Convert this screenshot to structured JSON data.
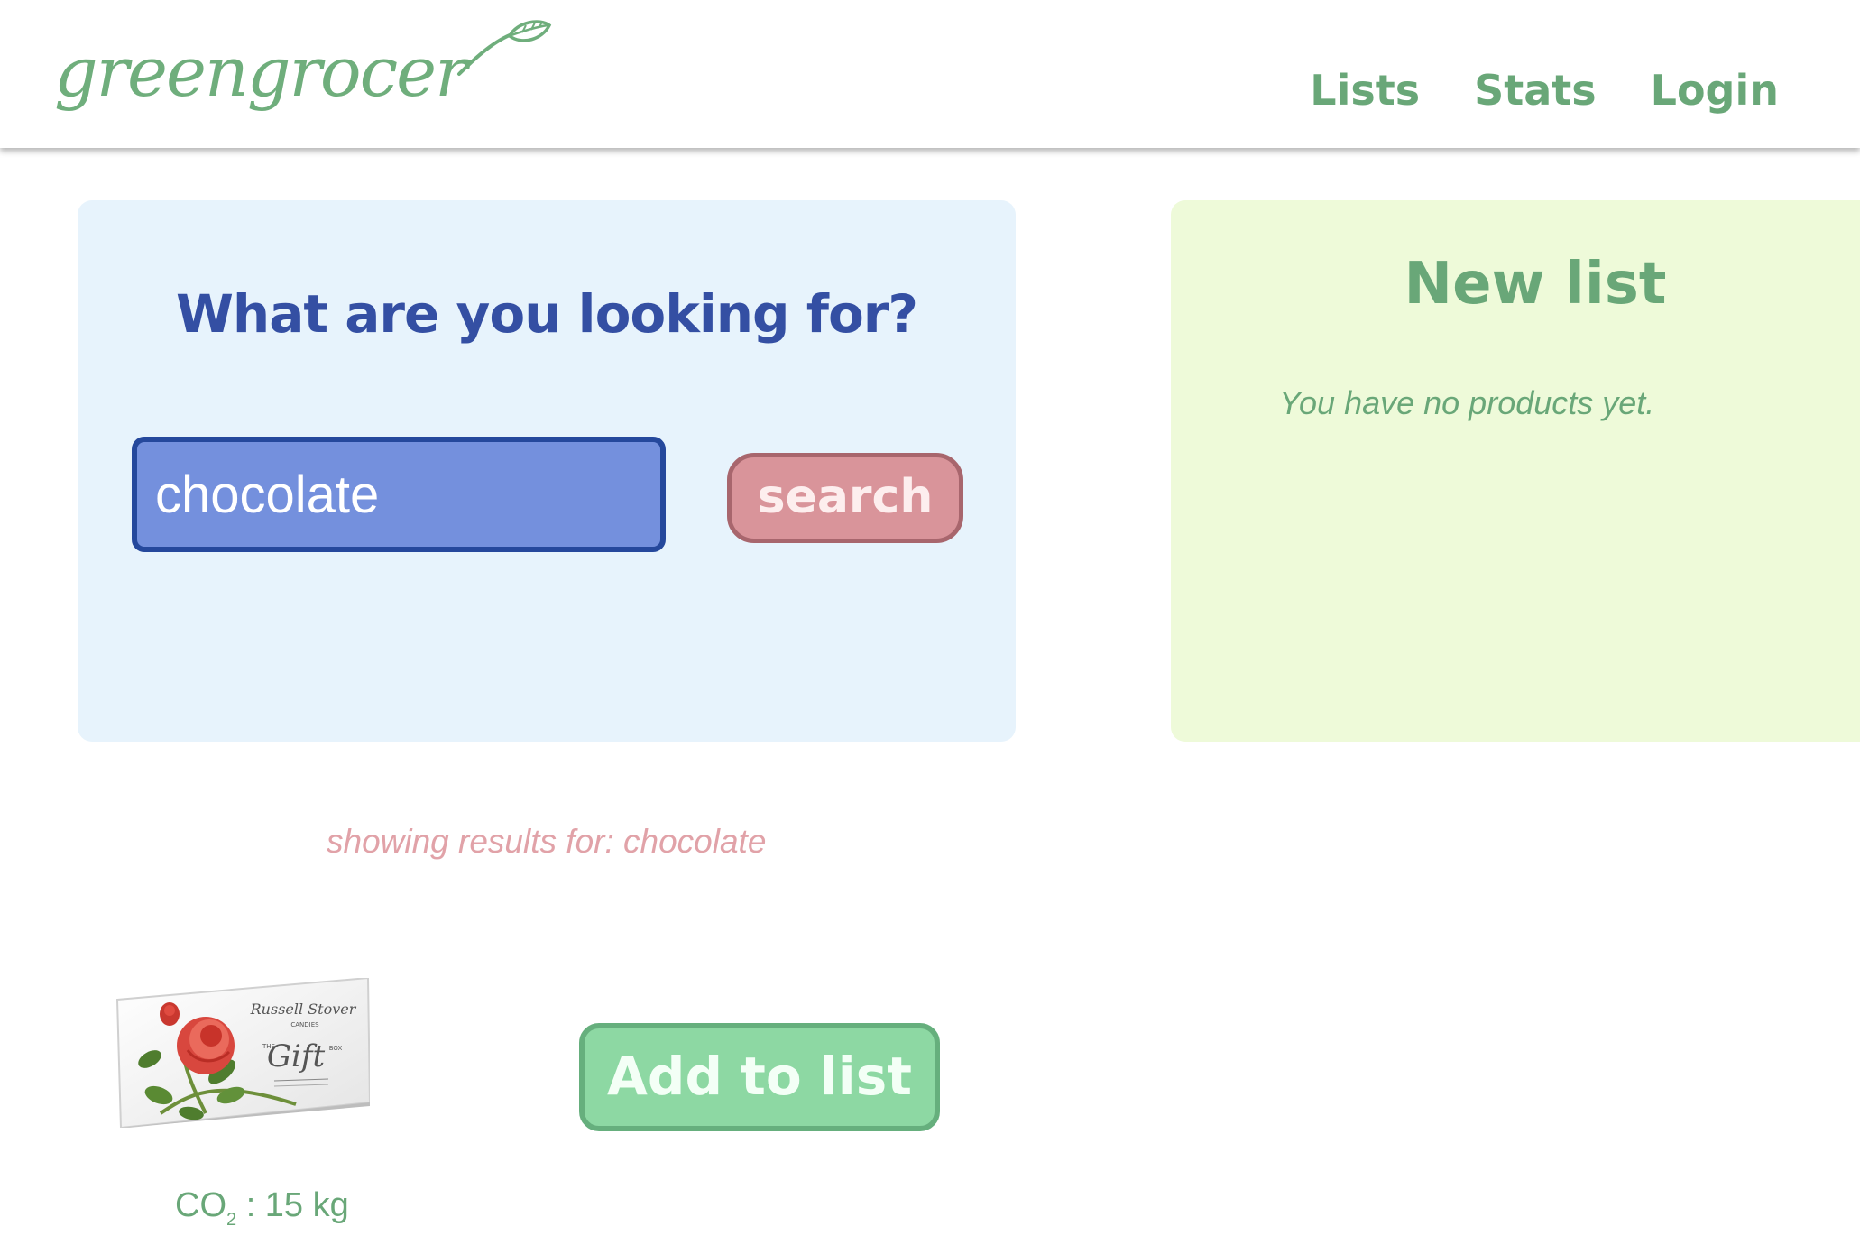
{
  "brand": {
    "name": "greengrocer",
    "color": "#6fae7c"
  },
  "nav": {
    "items": [
      {
        "label": "Lists"
      },
      {
        "label": "Stats"
      },
      {
        "label": "Login"
      }
    ]
  },
  "search": {
    "title": "What are you looking for?",
    "value": "chocolate",
    "button_label": "search"
  },
  "new_list": {
    "title": "New list",
    "empty_message": "You have no products yet."
  },
  "results": {
    "caption_prefix": "showing results for:",
    "query": "chocolate",
    "items": [
      {
        "image_icon": "product-gift-box-rose-image",
        "image_brand_text": "Russell Stover",
        "image_sub_text": "CANDIES",
        "image_gift_text": "Gift",
        "image_the_text": "THE",
        "image_box_text": "BOX",
        "add_label": "Add to list",
        "co2_label_main": "CO",
        "co2_label_sub": "2",
        "co2_value": ": 15 kg"
      }
    ]
  },
  "colors": {
    "header_green": "#69a778",
    "search_panel_bg": "#e7f3fc",
    "search_title": "#344fa3",
    "input_bg": "#7490dd",
    "input_border": "#25489c",
    "search_button_bg": "#d9949a",
    "list_panel_bg": "#eefad9",
    "caption_pink": "#e1a2a8",
    "add_button_bg": "#8dd8a3"
  }
}
